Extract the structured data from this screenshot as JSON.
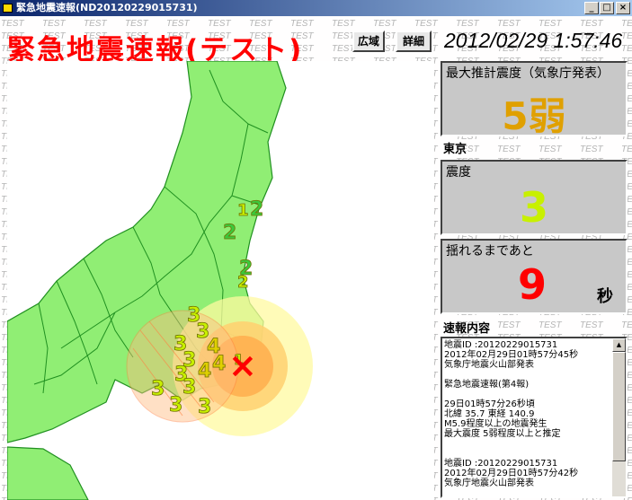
{
  "window": {
    "title": "緊急地震速報(ND20120229015731)",
    "buttons": {
      "minimize": "_",
      "maximize": "□",
      "close": "×"
    }
  },
  "header": {
    "title": "緊急地震速報(テスト)",
    "wide_button": "広域",
    "detail_button": "詳細",
    "datetime": "2012/02/29 1:57:46"
  },
  "watermark": "TEST",
  "max_intensity": {
    "label": "最大推計震度（気象庁発表）",
    "value": "5弱"
  },
  "local": {
    "region": "東京",
    "intensity_label": "震度",
    "intensity_value": "3",
    "countdown_label": "揺れるまであと",
    "countdown_value": "9",
    "countdown_unit": "秒"
  },
  "bulletin": {
    "label": "速報内容",
    "text": "地震ID :20120229015731\n2012年02月29日01時57分45秒\n気象庁地震火山部発表\n\n緊急地震速報(第4報)\n\n29日01時57分26秒頃\n北緯 35.7 東経 140.9\nM5.9程度以上の地震発生\n最大震度 5弱程度以上と推定\n\n\n地震ID :20120229015731\n2012年02月29日01時57分42秒\n気象庁地震火山部発表"
  },
  "map": {
    "epicenter_marker": "×",
    "intensity_labels": [
      "2",
      "2",
      "1",
      "2",
      "2",
      "3",
      "3",
      "4",
      "4",
      "3",
      "3",
      "3",
      "4",
      "3",
      "3",
      "3",
      "3",
      "1"
    ]
  },
  "colors": {
    "land": "#90ee74",
    "accent_red": "#ff0000",
    "intensity_5lower": "#e0a000",
    "intensity_3": "#c8f000"
  }
}
